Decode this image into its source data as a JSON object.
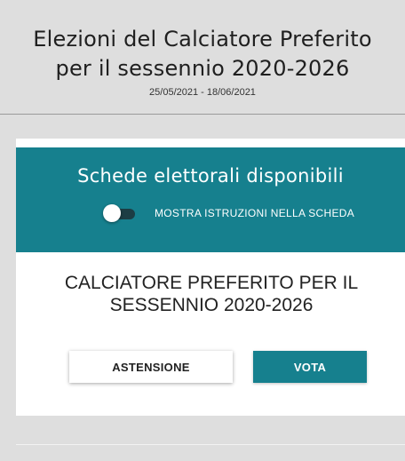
{
  "header": {
    "title_line1": "Elezioni del Calciatore Preferito",
    "title_line2": "per il sessennio 2020-2026",
    "dates": "25/05/2021 - 18/06/2021"
  },
  "ballots": {
    "banner_title": "Schede elettorali disponibili",
    "toggle_label": "MOSTRA ISTRUZIONI NELLA SCHEDA",
    "toggle_on": false,
    "ballot_title_line1": "CALCIATORE PREFERITO PER IL",
    "ballot_title_line2": "SESSENNIO 2020-2026",
    "abstain_label": "ASTENSIONE",
    "vote_label": "VOTA"
  },
  "colors": {
    "accent": "#16808e",
    "background": "#dedede",
    "toggle_track": "#1c3d44"
  }
}
